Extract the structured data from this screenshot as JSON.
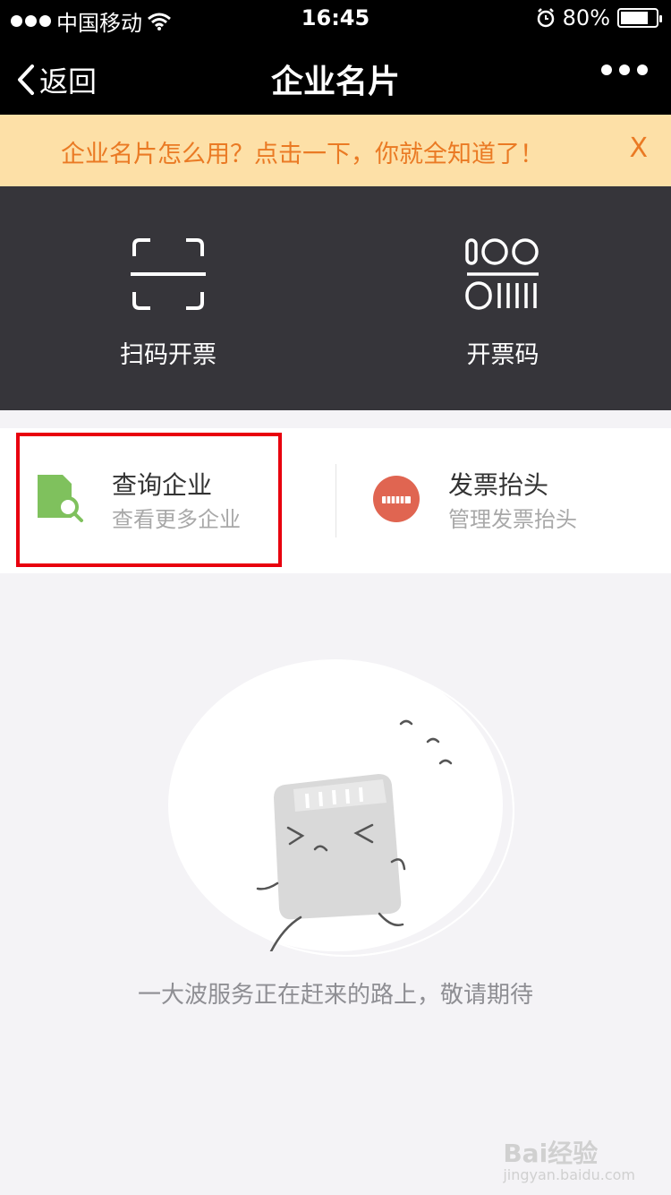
{
  "status_bar": {
    "carrier": "中国移动",
    "time": "16:45",
    "battery": "80%",
    "battery_level": 0.8,
    "signal_bars_filled": 3,
    "signal_bars_total": 5
  },
  "nav": {
    "back_label": "返回",
    "title": "企业名片"
  },
  "notice": {
    "text": "企业名片怎么用？点击一下，你就全知道了！",
    "close_label": "X"
  },
  "actions": [
    {
      "label": "扫码开票",
      "icon": "scan-icon"
    },
    {
      "label": "开票码",
      "icon": "invoice-code-icon"
    }
  ],
  "cards": [
    {
      "title": "查询企业",
      "subtitle": "查看更多企业",
      "icon": "document-search-icon",
      "icon_color": "#7fc15d"
    },
    {
      "title": "发票抬头",
      "subtitle": "管理发票抬头",
      "icon": "invoice-header-icon",
      "icon_color": "#e06551"
    }
  ],
  "empty_state": {
    "message": "一大波服务正在赶来的路上，敬请期待"
  },
  "watermark": {
    "brand": "Bai经验",
    "url": "jingyan.baidu.com"
  },
  "colors": {
    "notice_bg": "#fde0a7",
    "notice_text": "#ea7a24",
    "actions_bg": "#36353a",
    "highlight": "#e8000e"
  }
}
